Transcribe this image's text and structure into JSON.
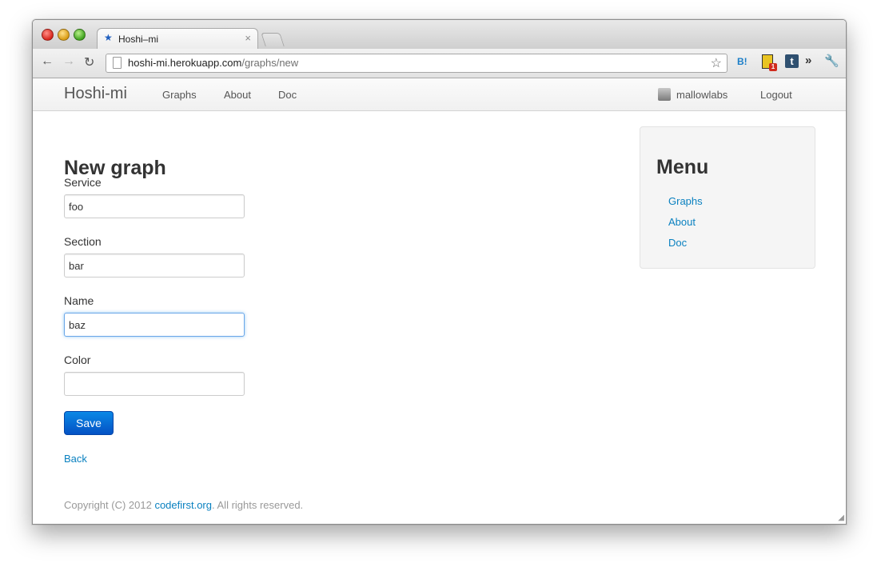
{
  "browser": {
    "tab_title": "Hoshi–mi",
    "url_host": "hoshi-mi.herokuapp.com",
    "url_path": "/graphs/new",
    "extensions": [
      "hatena-bookmark-icon",
      "bar-badge-icon",
      "tumblr-icon",
      "more-extensions-icon",
      "wrench-icon"
    ],
    "ext_hatena_label": "B!",
    "ext_badge_count": "1",
    "ext_tumblr_label": "t"
  },
  "navbar": {
    "brand": "Hoshi-mi",
    "links": [
      "Graphs",
      "About",
      "Doc"
    ],
    "user": "mallowlabs",
    "logout": "Logout"
  },
  "form": {
    "heading": "New graph",
    "fields": [
      {
        "label": "Service",
        "value": "foo"
      },
      {
        "label": "Section",
        "value": "bar"
      },
      {
        "label": "Name",
        "value": "baz"
      },
      {
        "label": "Color",
        "value": ""
      }
    ],
    "save_label": "Save",
    "back_label": "Back"
  },
  "sidebar": {
    "title": "Menu",
    "links": [
      "Graphs",
      "About",
      "Doc"
    ]
  },
  "footer": {
    "prefix": "Copyright (C) 2012 ",
    "link": "codefirst.org",
    "suffix": ". All rights reserved."
  },
  "colors": {
    "link": "#0a81c0",
    "save_button": "#0a6fd8"
  }
}
